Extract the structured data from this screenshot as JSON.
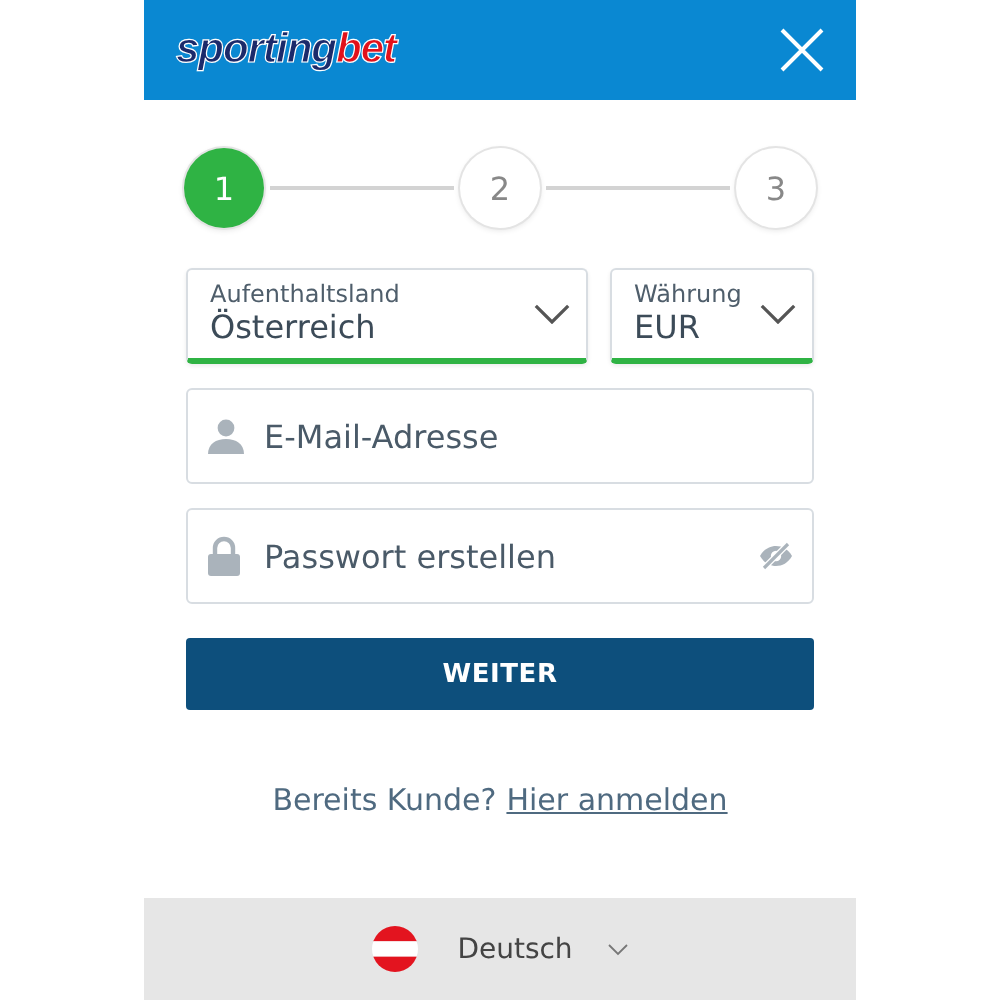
{
  "header": {
    "logo": [
      "sporting",
      "bet"
    ]
  },
  "steps": [
    {
      "label": "1",
      "selected": true
    },
    {
      "label": "2",
      "selected": false
    },
    {
      "label": "3",
      "selected": false
    }
  ],
  "selects": [
    {
      "label": "Aufenthaltsland",
      "value": "Österreich",
      "valid": true
    },
    {
      "label": "Währung",
      "value": "EUR",
      "valid": true
    }
  ],
  "fields": [
    {
      "kind": "email",
      "placeholder": "E-Mail-Adresse"
    },
    {
      "kind": "password",
      "placeholder": "Passwort erstellen"
    }
  ],
  "submit": "WEITER",
  "login": {
    "text": "Bereits Kunde?",
    "link": "Hier anmelden"
  },
  "footer": {
    "language": "Deutsch"
  }
}
